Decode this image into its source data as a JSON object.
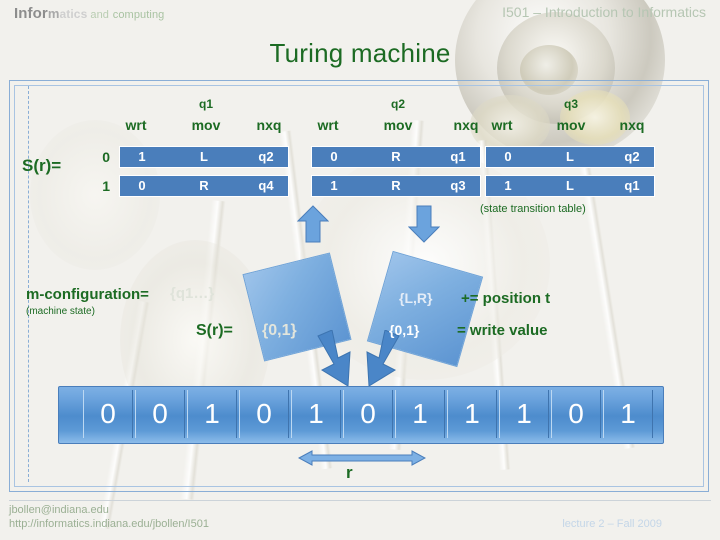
{
  "header": {
    "logo": {
      "part1": "Infor",
      "part2": "m",
      "part3": "atics",
      "part4": "and",
      "part5": "computing"
    },
    "course_title": "I501 – Introduction to Informatics",
    "slide_title": "Turing machine"
  },
  "table": {
    "row_label": "S(r)=",
    "caption": "(state transition table)",
    "groups": [
      "q1",
      "q2",
      "q3"
    ],
    "columns": [
      "wrt",
      "mov",
      "nxq"
    ],
    "row_keys": [
      "0",
      "1"
    ],
    "rows": [
      [
        "1",
        "L",
        "q2",
        "0",
        "R",
        "q1",
        "0",
        "L",
        "q2"
      ],
      [
        "0",
        "R",
        "q4",
        "1",
        "R",
        "q3",
        "1",
        "L",
        "q1"
      ]
    ]
  },
  "annotations": {
    "m_configuration_label": "m-configuration=",
    "m_configuration_value": "{q1…}",
    "m_configuration_sub": "(machine state)",
    "sr_label": "S(r)=",
    "sr_value": "{0,1}",
    "move_set": "{L,R}",
    "move_desc": "+= position t",
    "write_set": "{0,1}",
    "write_desc": "= write value"
  },
  "tape": {
    "cells": [
      "0",
      "0",
      "1",
      "0",
      "1",
      "0",
      "1",
      "1",
      "1",
      "0",
      "1"
    ],
    "pointer_label": "r"
  },
  "footer": {
    "email": "jbollen@indiana.edu",
    "url": "http://informatics.indiana.edu/jbollen/I501",
    "lecture": "lecture 2 – Fall 2009"
  },
  "colors": {
    "green": "#1c6b23",
    "blue": "#4a7ebb",
    "tape_blue": "#5d95d2",
    "frame_blue": "#8aaed6",
    "muted_green": "#b6c6b3"
  }
}
